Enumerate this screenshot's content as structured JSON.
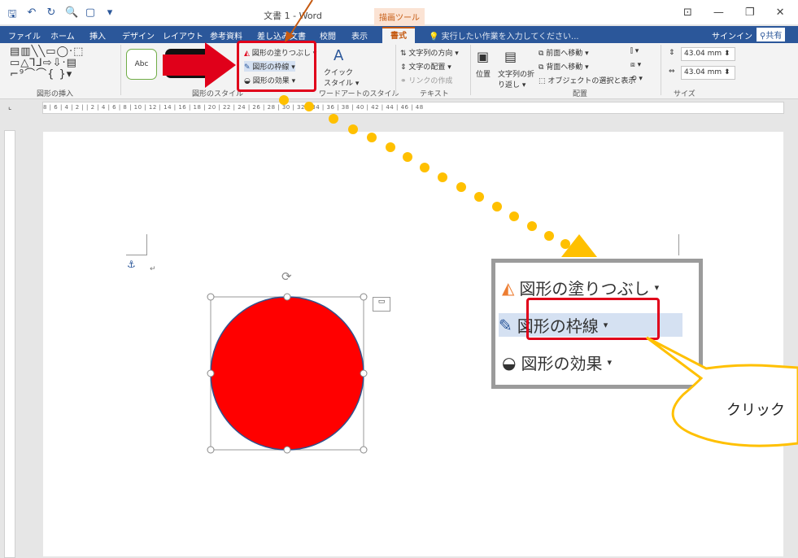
{
  "window": {
    "title": "文書 1 - Word",
    "context_tab": "描画ツール"
  },
  "tabs": [
    "ファイル",
    "ホーム",
    "挿入",
    "デザイン",
    "レイアウト",
    "参考資料",
    "差し込み文書",
    "校閲",
    "表示",
    "書式"
  ],
  "active_tab": "書式",
  "tell_me": "実行したい作業を入力してください...",
  "signin": "サインイン",
  "share": "共有",
  "ribbon": {
    "insert_shapes_label": "図形の挿入",
    "style_sample": "Abc",
    "shape_styles_label": "図形のスタイル",
    "fill": "図形の塗りつぶし",
    "outline": "図形の枠線",
    "effects": "図形の効果",
    "quick_styles_1": "クイック",
    "quick_styles_2": "スタイル",
    "wordart_label": "ワードアートのスタイル",
    "text_direction": "文字列の方向",
    "text_align": "文字の配置",
    "link": "リンクの作成",
    "text_label": "テキスト",
    "position": "位置",
    "wrap_1": "文字列の折",
    "wrap_2": "り返し",
    "bring_forward": "前面へ移動",
    "send_backward": "背面へ移動",
    "select_pane": "オブジェクトの選択と表示",
    "arrange_label": "配置",
    "height": "43.04 mm",
    "width": "43.04 mm",
    "size_label": "サイズ"
  },
  "ruler": "8 | 6 | 4 | 2 |  | 2 | 4 | 6 | 8 | 10 | 12 | 14 | 16 | 18 | 20 | 22 | 24 | 26 | 28 | 30 | 32 | 34 | 36 | 38 | 40 | 42 | 44 | 46 | 48",
  "zoom": {
    "fill": "図形の塗りつぶし",
    "outline": "図形の枠線",
    "effects": "図形の効果"
  },
  "callout_text": "クリック",
  "colors": {
    "brand": "#2b579a",
    "highlight": "#e0001a",
    "shape_fill": "#ff0000",
    "dots": "#ffc000"
  }
}
